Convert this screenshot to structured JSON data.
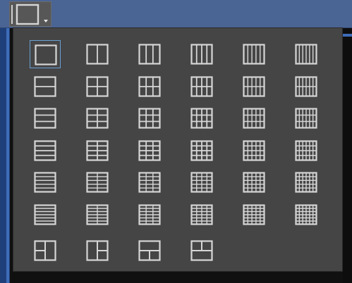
{
  "toolbar": {
    "layout_button": {
      "icon": "layout-single-icon",
      "caret_icon": "caret-down-icon"
    }
  },
  "colors": {
    "toolbar_bg": "#4a6494",
    "dropdown_bg": "#454545",
    "icon_stroke": "#d6d6d6",
    "selected_border": "#6aa0d4"
  },
  "layout_grid": {
    "selected": "1x1",
    "rows": [
      [
        {
          "id": "1x1",
          "name": "layout-1x1-icon",
          "rows": 1,
          "cols": 1
        },
        {
          "id": "1x2",
          "name": "layout-1x2-icon",
          "rows": 1,
          "cols": 2
        },
        {
          "id": "1x3",
          "name": "layout-1x3-icon",
          "rows": 1,
          "cols": 3
        },
        {
          "id": "1x4",
          "name": "layout-1x4-icon",
          "rows": 1,
          "cols": 4
        },
        {
          "id": "1x5",
          "name": "layout-1x5-icon",
          "rows": 1,
          "cols": 5
        },
        {
          "id": "1x6",
          "name": "layout-1x6-icon",
          "rows": 1,
          "cols": 6
        }
      ],
      [
        {
          "id": "2x1",
          "name": "layout-2x1-icon",
          "rows": 2,
          "cols": 1
        },
        {
          "id": "2x2",
          "name": "layout-2x2-icon",
          "rows": 2,
          "cols": 2
        },
        {
          "id": "2x3",
          "name": "layout-2x3-icon",
          "rows": 2,
          "cols": 3
        },
        {
          "id": "2x4",
          "name": "layout-2x4-icon",
          "rows": 2,
          "cols": 4
        },
        {
          "id": "2x5",
          "name": "layout-2x5-icon",
          "rows": 2,
          "cols": 5
        },
        {
          "id": "2x6",
          "name": "layout-2x6-icon",
          "rows": 2,
          "cols": 6
        }
      ],
      [
        {
          "id": "3x1",
          "name": "layout-3x1-icon",
          "rows": 3,
          "cols": 1
        },
        {
          "id": "3x2",
          "name": "layout-3x2-icon",
          "rows": 3,
          "cols": 2
        },
        {
          "id": "3x3",
          "name": "layout-3x3-icon",
          "rows": 3,
          "cols": 3
        },
        {
          "id": "3x4",
          "name": "layout-3x4-icon",
          "rows": 3,
          "cols": 4
        },
        {
          "id": "3x5",
          "name": "layout-3x5-icon",
          "rows": 3,
          "cols": 5
        },
        {
          "id": "3x6",
          "name": "layout-3x6-icon",
          "rows": 3,
          "cols": 6
        }
      ],
      [
        {
          "id": "4x1",
          "name": "layout-4x1-icon",
          "rows": 4,
          "cols": 1
        },
        {
          "id": "4x2",
          "name": "layout-4x2-icon",
          "rows": 4,
          "cols": 2
        },
        {
          "id": "4x3",
          "name": "layout-4x3-icon",
          "rows": 4,
          "cols": 3
        },
        {
          "id": "4x4",
          "name": "layout-4x4-icon",
          "rows": 4,
          "cols": 4
        },
        {
          "id": "4x5",
          "name": "layout-4x5-icon",
          "rows": 4,
          "cols": 5
        },
        {
          "id": "4x6",
          "name": "layout-4x6-icon",
          "rows": 4,
          "cols": 6
        }
      ],
      [
        {
          "id": "5x1",
          "name": "layout-5x1-icon",
          "rows": 5,
          "cols": 1
        },
        {
          "id": "5x2",
          "name": "layout-5x2-icon",
          "rows": 5,
          "cols": 2
        },
        {
          "id": "5x3",
          "name": "layout-5x3-icon",
          "rows": 5,
          "cols": 3
        },
        {
          "id": "5x4",
          "name": "layout-5x4-icon",
          "rows": 5,
          "cols": 4
        },
        {
          "id": "5x5",
          "name": "layout-5x5-icon",
          "rows": 5,
          "cols": 5
        },
        {
          "id": "5x6",
          "name": "layout-5x6-icon",
          "rows": 5,
          "cols": 6
        }
      ],
      [
        {
          "id": "6x1",
          "name": "layout-6x1-icon",
          "rows": 6,
          "cols": 1
        },
        {
          "id": "6x2",
          "name": "layout-6x2-icon",
          "rows": 6,
          "cols": 2
        },
        {
          "id": "6x3",
          "name": "layout-6x3-icon",
          "rows": 6,
          "cols": 3
        },
        {
          "id": "6x4",
          "name": "layout-6x4-icon",
          "rows": 6,
          "cols": 4
        },
        {
          "id": "6x5",
          "name": "layout-6x5-icon",
          "rows": 6,
          "cols": 5
        },
        {
          "id": "6x6",
          "name": "layout-6x6-icon",
          "rows": 6,
          "cols": 6
        }
      ],
      [
        {
          "id": "custom-left-col",
          "name": "layout-left-column-split-icon",
          "special": "left"
        },
        {
          "id": "custom-right-col",
          "name": "layout-right-column-split-icon",
          "special": "right"
        },
        {
          "id": "custom-bottom-row",
          "name": "layout-bottom-row-split-icon",
          "special": "bottom"
        },
        {
          "id": "custom-top-row",
          "name": "layout-top-row-split-icon",
          "special": "top"
        }
      ]
    ]
  }
}
